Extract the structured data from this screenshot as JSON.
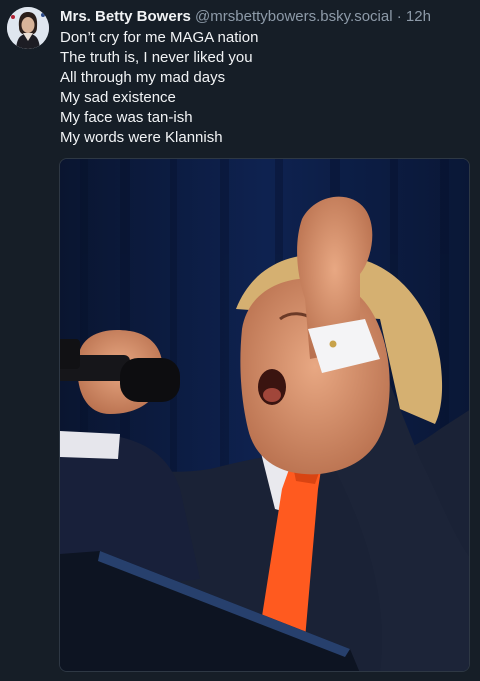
{
  "post": {
    "author_name": "Mrs. Betty Bowers",
    "author_handle": "@mrsbettybowers.bsky.social",
    "separator": "·",
    "timestamp": "12h",
    "lines": [
      "Don’t cry for me MAGA nation",
      "The truth is, I never liked you",
      "All through my mad days",
      "My sad existence",
      "My face was tan-ish",
      "My words were Klannish"
    ]
  },
  "colors": {
    "background": "#161e27",
    "text": "#f1f3f5",
    "muted": "#8d9aa8"
  }
}
